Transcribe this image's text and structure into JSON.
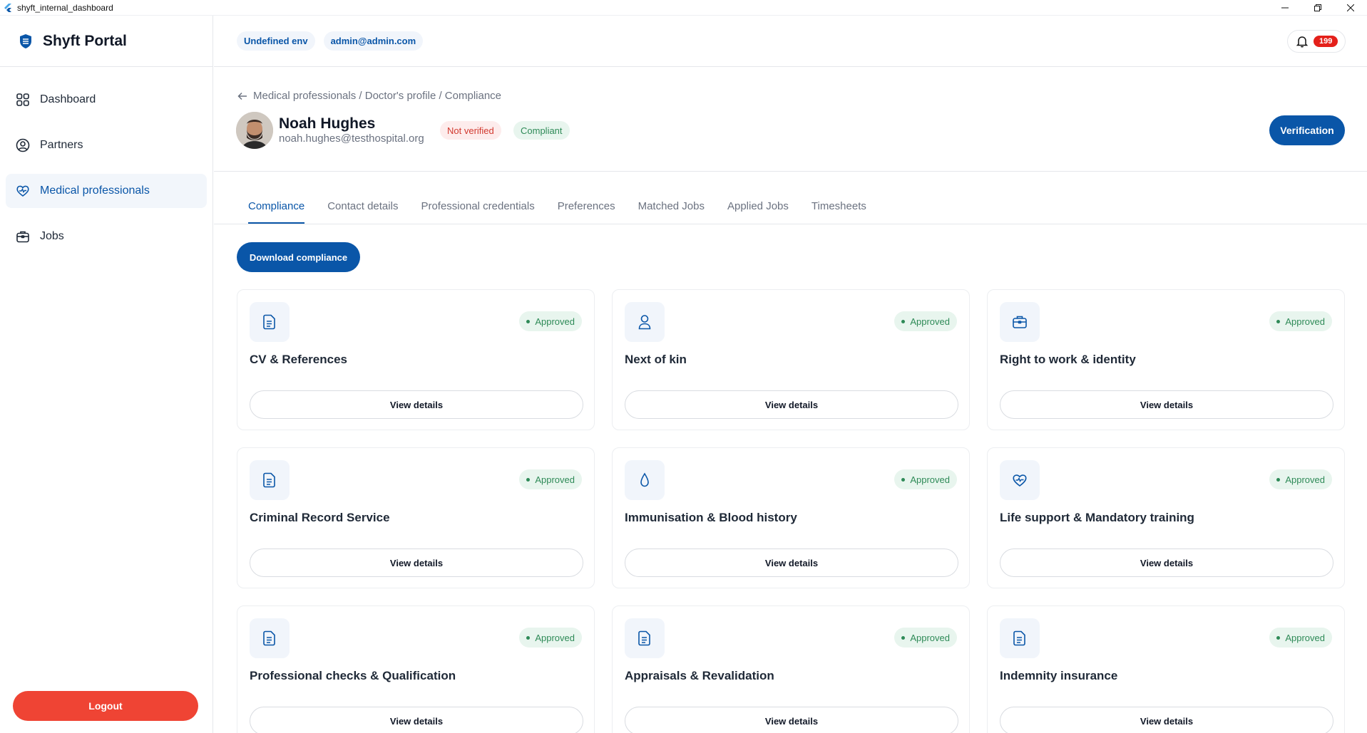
{
  "window": {
    "title": "shyft_internal_dashboard"
  },
  "brand": {
    "name": "Shyft Portal"
  },
  "sidebar": {
    "items": [
      {
        "label": "Dashboard",
        "icon": "grid-icon",
        "active": false
      },
      {
        "label": "Partners",
        "icon": "user-circle-icon",
        "active": false
      },
      {
        "label": "Medical professionals",
        "icon": "heart-pulse-icon",
        "active": true
      },
      {
        "label": "Jobs",
        "icon": "briefcase-icon",
        "active": false
      }
    ],
    "logout_label": "Logout"
  },
  "header": {
    "env_label": "Undefined env",
    "user_email": "admin@admin.com",
    "notification_count": "199"
  },
  "breadcrumb": "Medical professionals / Doctor's profile / Compliance",
  "profile": {
    "name": "Noah Hughes",
    "email": "noah.hughes@testhospital.org",
    "status_verification": "Not verified",
    "status_compliance": "Compliant",
    "verification_button": "Verification"
  },
  "tabs": [
    {
      "label": "Compliance",
      "active": true
    },
    {
      "label": "Contact details",
      "active": false
    },
    {
      "label": "Professional credentials",
      "active": false
    },
    {
      "label": "Preferences",
      "active": false
    },
    {
      "label": "Matched Jobs",
      "active": false
    },
    {
      "label": "Applied Jobs",
      "active": false
    },
    {
      "label": "Timesheets",
      "active": false
    }
  ],
  "download_button": "Download compliance",
  "cards": [
    {
      "title": "CV & References",
      "status": "Approved",
      "icon": "document-icon",
      "button": "View details"
    },
    {
      "title": "Next of kin",
      "status": "Approved",
      "icon": "person-icon",
      "button": "View details"
    },
    {
      "title": "Right to work & identity",
      "status": "Approved",
      "icon": "briefcase-icon",
      "button": "View details"
    },
    {
      "title": "Criminal Record Service",
      "status": "Approved",
      "icon": "document-icon",
      "button": "View details"
    },
    {
      "title": "Immunisation & Blood history",
      "status": "Approved",
      "icon": "drop-icon",
      "button": "View details"
    },
    {
      "title": "Life support & Mandatory training",
      "status": "Approved",
      "icon": "heart-pulse-icon",
      "button": "View details"
    },
    {
      "title": "Professional checks & Qualification",
      "status": "Approved",
      "icon": "document-icon",
      "button": "View details"
    },
    {
      "title": "Appraisals & Revalidation",
      "status": "Approved",
      "icon": "document-icon",
      "button": "View details"
    },
    {
      "title": "Indemnity insurance",
      "status": "Approved",
      "icon": "document-icon",
      "button": "View details"
    }
  ],
  "colors": {
    "primary": "#0a56a8",
    "danger": "#ef4434",
    "badge": "#e4201a",
    "success": "#2e8a57",
    "success_bg": "#e8f5ee"
  }
}
